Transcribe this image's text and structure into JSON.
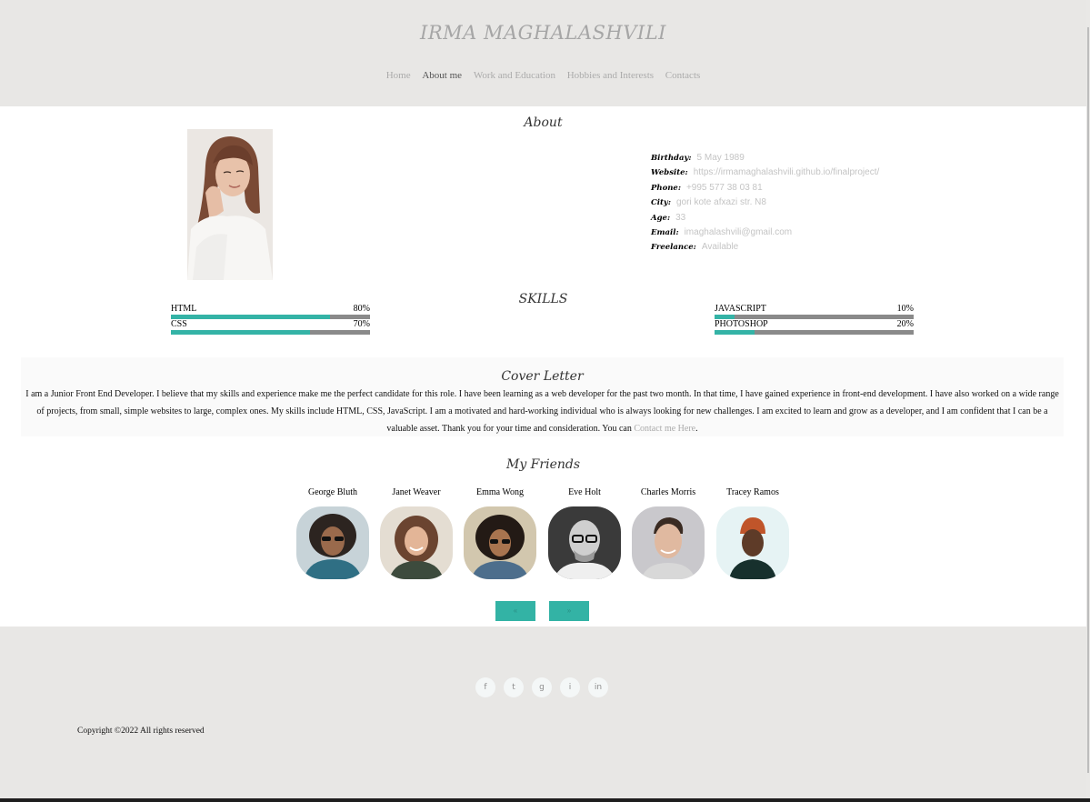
{
  "header": {
    "title": "IRMA MAGHALASHVILI",
    "nav": [
      "Home",
      "About me",
      "Work and Education",
      "Hobbies and Interests",
      "Contacts"
    ],
    "active_nav": "About me"
  },
  "about": {
    "title": "About",
    "info": [
      {
        "key": "Birthday:",
        "value": "5 May 1989"
      },
      {
        "key": "Website:",
        "value": "https://irmamaghalashvili.github.io/finalproject/"
      },
      {
        "key": "Phone:",
        "value": "+995 577 38 03 81"
      },
      {
        "key": "City:",
        "value": "gori kote afxazi str. N8"
      },
      {
        "key": "Age:",
        "value": "33"
      },
      {
        "key": "Email:",
        "value": "imaghalashvili@gmail.com"
      },
      {
        "key": "Freelance:",
        "value": "Available"
      }
    ]
  },
  "skills": {
    "title": "SKILLS",
    "items": [
      {
        "name": "HTML",
        "percent_label": "80%",
        "level": 0.8
      },
      {
        "name": "CSS",
        "percent_label": "70%",
        "level": 0.7
      },
      {
        "name": "JAVASCRIPT",
        "percent_label": "10%",
        "level": 0.1
      },
      {
        "name": "PHOTOSHOP",
        "percent_label": "20%",
        "level": 0.2
      }
    ]
  },
  "cover_letter": {
    "title": "Cover Letter",
    "text": "I am a Junior Front End Developer. I believe that my skills and experience make me the perfect candidate for this role. I have been learning as a web developer for the past two month. In that time, I have gained experience in front-end development. I have also worked on a wide range of projects, from small, simple websites to large, complex ones. My skills include HTML, CSS, JavaScript. I am a motivated and hard-working individual who is always looking for new challenges. I am excited to learn and grow as a developer, and I am confident that I can be a valuable asset. Thank you for your time and consideration. You can ",
    "link_text": "Contact me Here",
    "tail": "."
  },
  "friends": {
    "title": "My Friends",
    "items": [
      {
        "name": "George Bluth"
      },
      {
        "name": "Janet Weaver"
      },
      {
        "name": "Emma Wong"
      },
      {
        "name": "Eve Holt"
      },
      {
        "name": "Charles Morris"
      },
      {
        "name": "Tracey Ramos"
      }
    ],
    "prev_label": "«",
    "next_label": "»"
  },
  "footer": {
    "social_icons": [
      {
        "name": "facebook-icon",
        "glyph": "f"
      },
      {
        "name": "twitter-icon",
        "glyph": "t"
      },
      {
        "name": "github-icon",
        "glyph": "g"
      },
      {
        "name": "instagram-icon",
        "glyph": "i"
      },
      {
        "name": "linkedin-icon",
        "glyph": "in"
      }
    ],
    "copyright": "Copyright ©2022 All rights reserved"
  },
  "colors": {
    "accent": "#34b3a6",
    "header_bg": "#e8e7e5",
    "bar_track": "#8a8a8a"
  }
}
